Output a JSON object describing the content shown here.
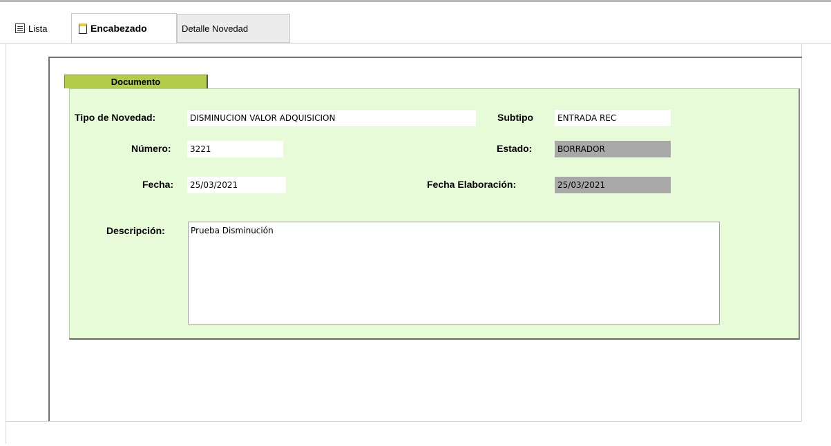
{
  "tabs": [
    {
      "label": "Lista",
      "icon": "list-icon"
    },
    {
      "label": "Encabezado",
      "icon": "document-icon",
      "active": true
    },
    {
      "label": "Detalle Novedad"
    }
  ],
  "section_title": "Documento",
  "form": {
    "tipo_label": "Tipo de Novedad:",
    "tipo_value": "DISMINUCION VALOR ADQUISICION",
    "subtipo_label": "Subtipo",
    "subtipo_value": "ENTRADA REC",
    "numero_label": "Número:",
    "numero_value": "3221",
    "estado_label": "Estado:",
    "estado_value": "BORRADOR",
    "fecha_label": "Fecha:",
    "fecha_value": "25/03/2021",
    "fecha_elab_label": "Fecha Elaboración:",
    "fecha_elab_value": "25/03/2021",
    "descripcion_label": "Descripción:",
    "descripcion_value": "Prueba Disminución"
  },
  "colors": {
    "section_tab": "#b2cc48",
    "panel_bg": "#e8fbd8",
    "readonly_field": "#a8a8a8"
  }
}
